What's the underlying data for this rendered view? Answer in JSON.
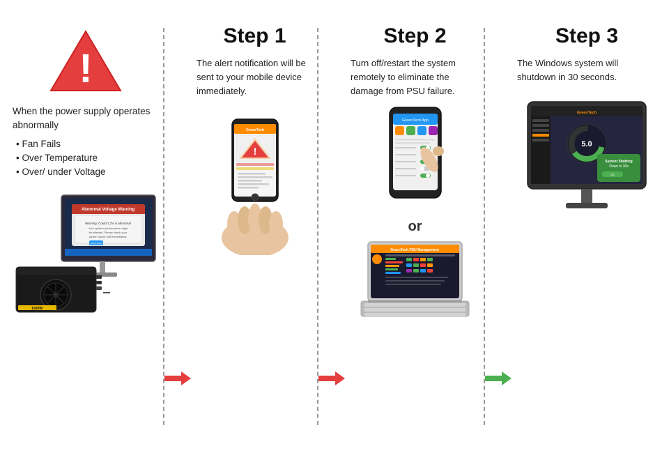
{
  "columns": [
    {
      "id": "col1",
      "intro_text": "When the power supply operates abnormally",
      "bullets": [
        "Fan Fails",
        "Over Temperature",
        "Over/ under Voltage"
      ]
    },
    {
      "id": "col2",
      "step_label": "Step 1",
      "description": "The alert notification will be sent to your mobile device immediately."
    },
    {
      "id": "col3",
      "step_label": "Step 2",
      "description": "Turn off/restart the system remotely to eliminate the damage from PSU failure.",
      "or_text": "or"
    },
    {
      "id": "col4",
      "step_label": "Step 3",
      "description": "The Windows system will shutdown in 30 seconds."
    }
  ],
  "arrows": {
    "red": "→",
    "green": "→"
  }
}
